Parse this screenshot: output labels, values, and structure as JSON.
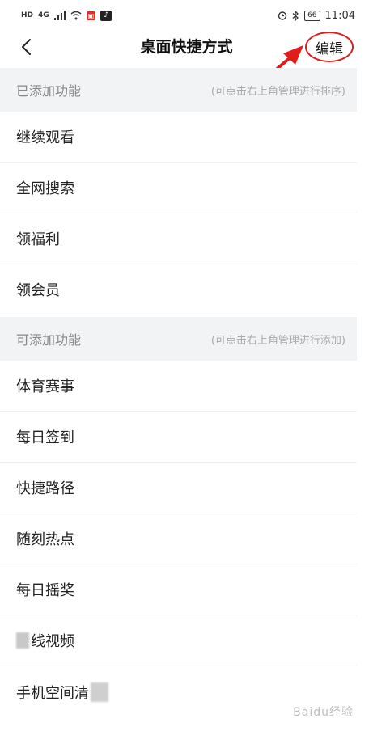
{
  "status_bar": {
    "network_hd": "HD",
    "network_gen": "4G",
    "time": "11:04",
    "battery": "66"
  },
  "header": {
    "title": "桌面快捷方式",
    "edit_label": "编辑"
  },
  "sections": {
    "added": {
      "title": "已添加功能",
      "hint": "(可点击右上角管理进行排序)",
      "items": [
        "继续观看",
        "全网搜索",
        "领福利",
        "领会员"
      ]
    },
    "available": {
      "title": "可添加功能",
      "hint": "(可点击右上角管理进行添加)",
      "items": [
        "体育赛事",
        "每日签到",
        "快捷路径",
        "随刻热点",
        "每日摇奖",
        "线视频",
        "手机空间清"
      ]
    }
  },
  "watermark": "Baidu经验",
  "colors": {
    "annotation_red": "#e21b1b",
    "section_bg": "#f2f3f5"
  }
}
